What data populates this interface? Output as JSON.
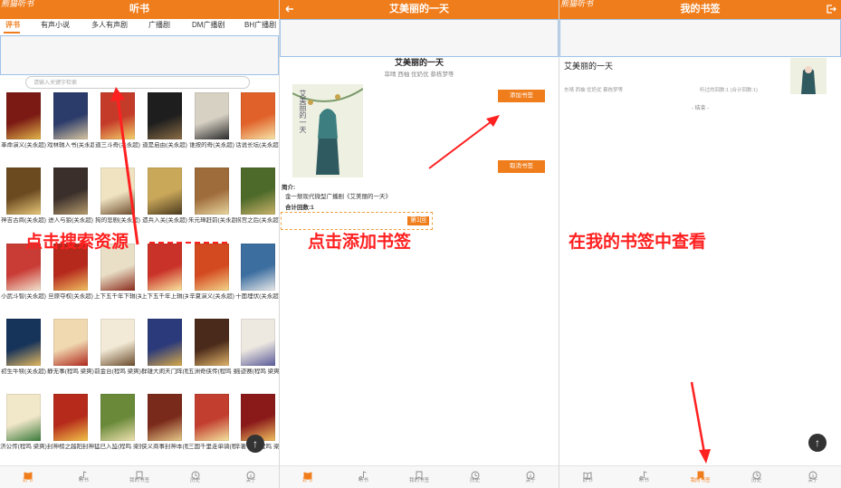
{
  "colors": {
    "accent": "#f07d1b",
    "annotation_red": "#ff2020",
    "frame_blue": "#9dc3ea"
  },
  "panel1": {
    "logo": "熊猫听书",
    "title": "听书",
    "tabs": [
      "评书",
      "有声小说",
      "多人有声剧",
      "广播剧",
      "DM广播剧",
      "BH广播剧"
    ],
    "search_placeholder": "请输入关键字检索",
    "books": [
      "革命演义(关永超)",
      "戏林辑人书(关永超)",
      "道三斗奇(关永超)",
      "道是启由(关永超)",
      "谁按的奇(关永超)",
      "话说长坛(关永超)",
      "神吉古商(关永超)",
      "进人与狼(关永超)",
      "狗的悲剧(关永超)",
      "遗兵入关(关永超)",
      "朱元璋赶前(关永超)",
      "拐宫之后(关永超)",
      "小武斗智(关永超)",
      "旦原夺权(关永超)",
      "上下五千年下辑(关永超)",
      "上下五千年上辑(关永超)",
      "辛夏演义(关永超)",
      "十面埋伏(关永超)",
      "初生牛犊(关永超)",
      "静无事(程鸣 梁爽)",
      "前金台(程鸣 梁爽)",
      "群雄大闹天门阵(程鸣 梁爽)",
      "五洲奇侠传(程鸣 梁爽)",
      "摇迹赛(程鸣 梁爽)",
      "济公传(程鸣 梁爽)",
      "封神榜之越阳封神(程鸣 梁爽)",
      "猛已入监(程鸣 梁爽)",
      "侠义商事封神本(程鸣 梁爽)",
      "三国千里走单骑(程鸣 梁爽)",
      "辛署一声(程鸣 梁爽)"
    ],
    "nav": [
      "好书",
      "听书",
      "我的书签",
      "历史",
      "关于"
    ],
    "annotation": "点击搜索资源"
  },
  "panel2": {
    "title": "艾美丽的一天",
    "book_title": "艾美丽的一天",
    "book_author": "菲晴 西柚 优奶优 蔡栋梦等",
    "cover_text": "艾美丽的一天",
    "add_button": "添加书签",
    "cancel_button": "取消书签",
    "intro_label": "简介:",
    "intro_text": "金一颓现代微型广播剧《艾美丽的一天》",
    "total_label": "合计回数:1",
    "episode_badge": "第1回",
    "nav": [
      "好书",
      "听书",
      "我的书签",
      "历史",
      "关于"
    ],
    "annotation": "点击添加书签"
  },
  "panel3": {
    "logo": "熊猫听书",
    "title": "我的书签",
    "bookmark_title": "艾美丽的一天",
    "bookmark_author": "东晴 西柚 优奶优 蔡栋梦等",
    "bookmark_meta": "听过的回数:1  (合计回数:1)",
    "end_text": "- 结束 -",
    "nav": [
      "好书",
      "听书",
      "我的书签",
      "历史",
      "关于"
    ],
    "annotation": "在我的书签中查看"
  }
}
